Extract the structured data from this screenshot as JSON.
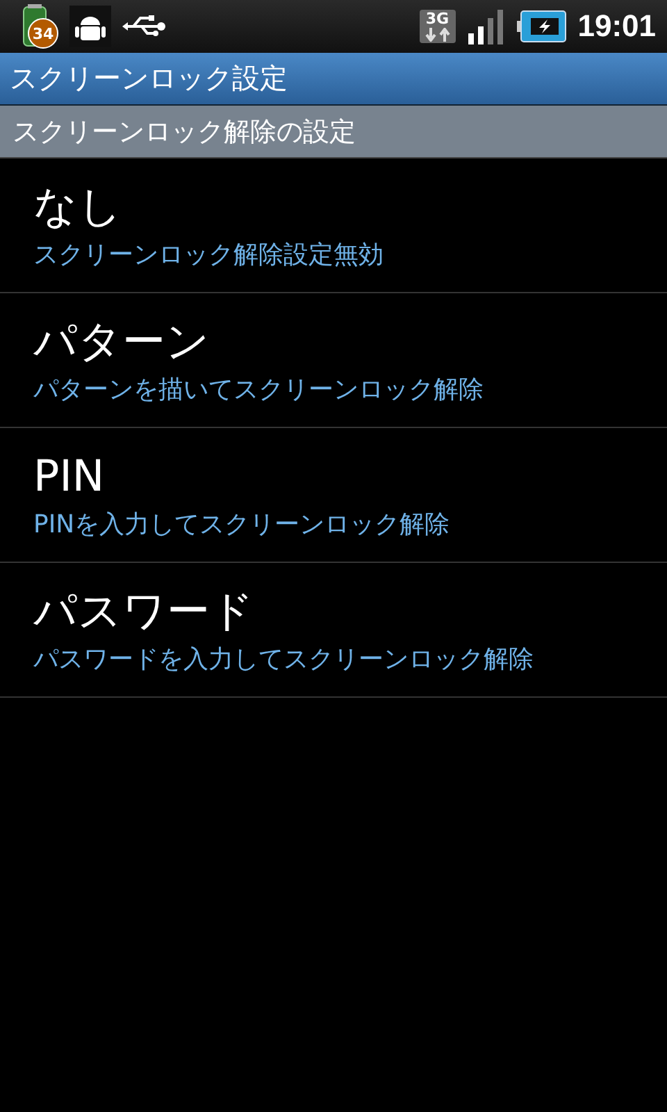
{
  "status_bar": {
    "badge": "34",
    "network": "3G",
    "time": "19:01"
  },
  "title_bar": {
    "title": "スクリーンロック設定"
  },
  "section": {
    "title": "スクリーンロック解除の設定"
  },
  "options": [
    {
      "title": "なし",
      "summary": "スクリーンロック解除設定無効"
    },
    {
      "title": "パターン",
      "summary": "パターンを描いてスクリーンロック解除"
    },
    {
      "title": "PIN",
      "summary": "PINを入力してスクリーンロック解除"
    },
    {
      "title": "パスワード",
      "summary": "パスワードを入力してスクリーンロック解除"
    }
  ]
}
